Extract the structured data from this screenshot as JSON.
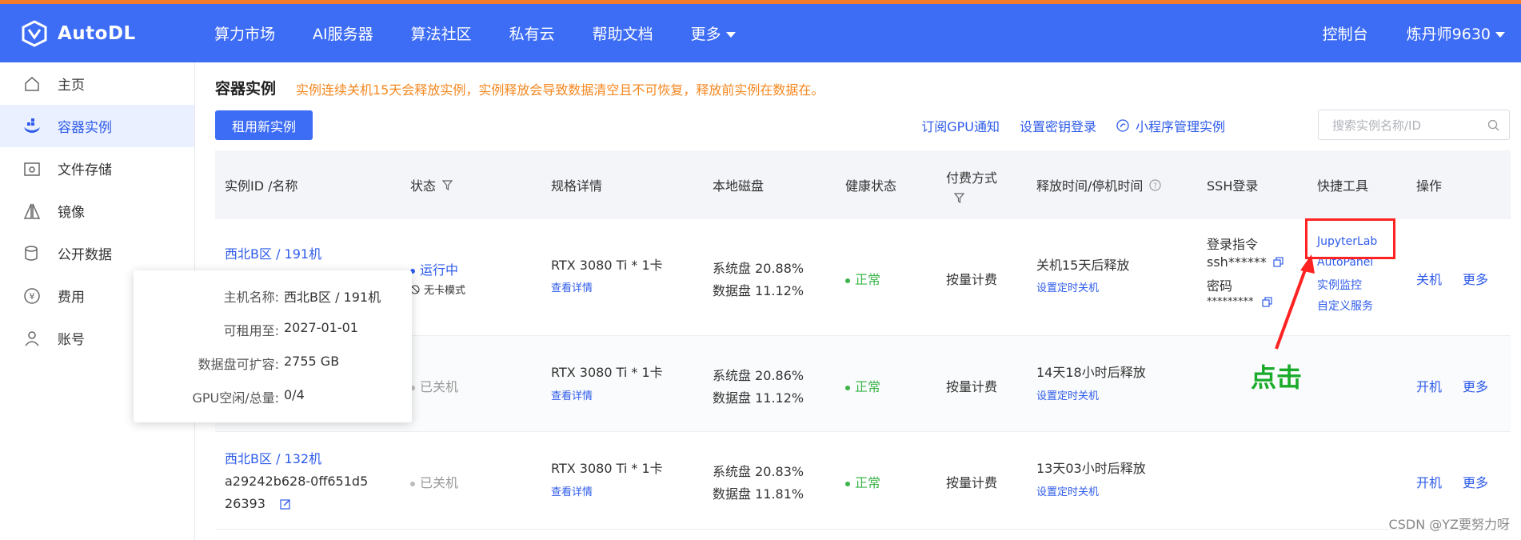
{
  "brand": {
    "name": "AutoDL",
    "accent": "#3d6cf5",
    "topline": "#f47b2a"
  },
  "nav": [
    "算力市场",
    "AI服务器",
    "算法社区",
    "私有云",
    "帮助文档",
    "更多"
  ],
  "top_right": {
    "console": "控制台",
    "user": "炼丹师9630"
  },
  "sidebar": [
    {
      "label": "主页",
      "icon": "home-icon"
    },
    {
      "label": "容器实例",
      "icon": "container-icon"
    },
    {
      "label": "文件存储",
      "icon": "storage-icon"
    },
    {
      "label": "镜像",
      "icon": "image-icon"
    },
    {
      "label": "公开数据",
      "icon": "database-icon"
    },
    {
      "label": "费用",
      "icon": "yen-icon"
    },
    {
      "label": "账号",
      "icon": "user-icon"
    }
  ],
  "page": {
    "title": "容器实例",
    "warning": "实例连续关机15天会释放实例，实例释放会导致数据清空且不可恢复，释放前实例在数据在。",
    "new_button": "租用新实例",
    "links": [
      "订阅GPU通知",
      "设置密钥登录",
      "小程序管理实例"
    ],
    "search_placeholder": "搜索实例名称/ID"
  },
  "table": {
    "headers": [
      "实例ID /名称",
      "状态",
      "规格详情",
      "本地磁盘",
      "健康状态",
      "付费方式",
      "释放时间/停机时间",
      "SSH登录",
      "快捷工具",
      "操作"
    ],
    "rows": [
      {
        "name": "西北B区 / 191机",
        "status": "运行中",
        "status_sub": "无卡模式",
        "spec": "RTX 3080 Ti * 1卡",
        "spec_link": "查看详情",
        "disk_sys": "系统盘 20.88%",
        "disk_data": "数据盘 11.12%",
        "health": "正常",
        "pay": "按量计费",
        "release": "关机15天后释放",
        "release_link": "设置定时关机",
        "ssh_cmd_label": "登录指令",
        "ssh_cmd": "ssh******",
        "ssh_pwd_label": "密码",
        "ssh_pwd": "*********",
        "tools": [
          "JupyterLab",
          "AutoPanel",
          "实例监控",
          "自定义服务"
        ],
        "ops": [
          "关机",
          "更多"
        ]
      },
      {
        "status": "已关机",
        "spec": "RTX 3080 Ti * 1卡",
        "spec_link": "查看详情",
        "disk_sys": "系统盘 20.86%",
        "disk_data": "数据盘 11.12%",
        "health": "正常",
        "pay": "按量计费",
        "release": "14天18小时后释放",
        "release_link": "设置定时关机",
        "ops": [
          "开机",
          "更多"
        ]
      },
      {
        "name": "西北B区 / 132机",
        "id_line1": "a29242b628-0ff651d5",
        "id_line2": "26393",
        "status": "已关机",
        "spec": "RTX 3080 Ti * 1卡",
        "spec_link": "查看详情",
        "disk_sys": "系统盘 20.83%",
        "disk_data": "数据盘 11.81%",
        "health": "正常",
        "pay": "按量计费",
        "release": "13天03小时后释放",
        "release_link": "设置定时关机",
        "ops": [
          "开机",
          "更多"
        ]
      }
    ]
  },
  "popup": {
    "rows": [
      {
        "label": "主机名称:",
        "value": "西北B区 / 191机"
      },
      {
        "label": "可租用至:",
        "value": "2027-01-01"
      },
      {
        "label": "数据盘可扩容:",
        "value": "2755 GB"
      },
      {
        "label": "GPU空闲/总量:",
        "value": "0/4"
      }
    ]
  },
  "annotation": {
    "text": "点击"
  },
  "watermark": "CSDN @YZ要努力呀"
}
